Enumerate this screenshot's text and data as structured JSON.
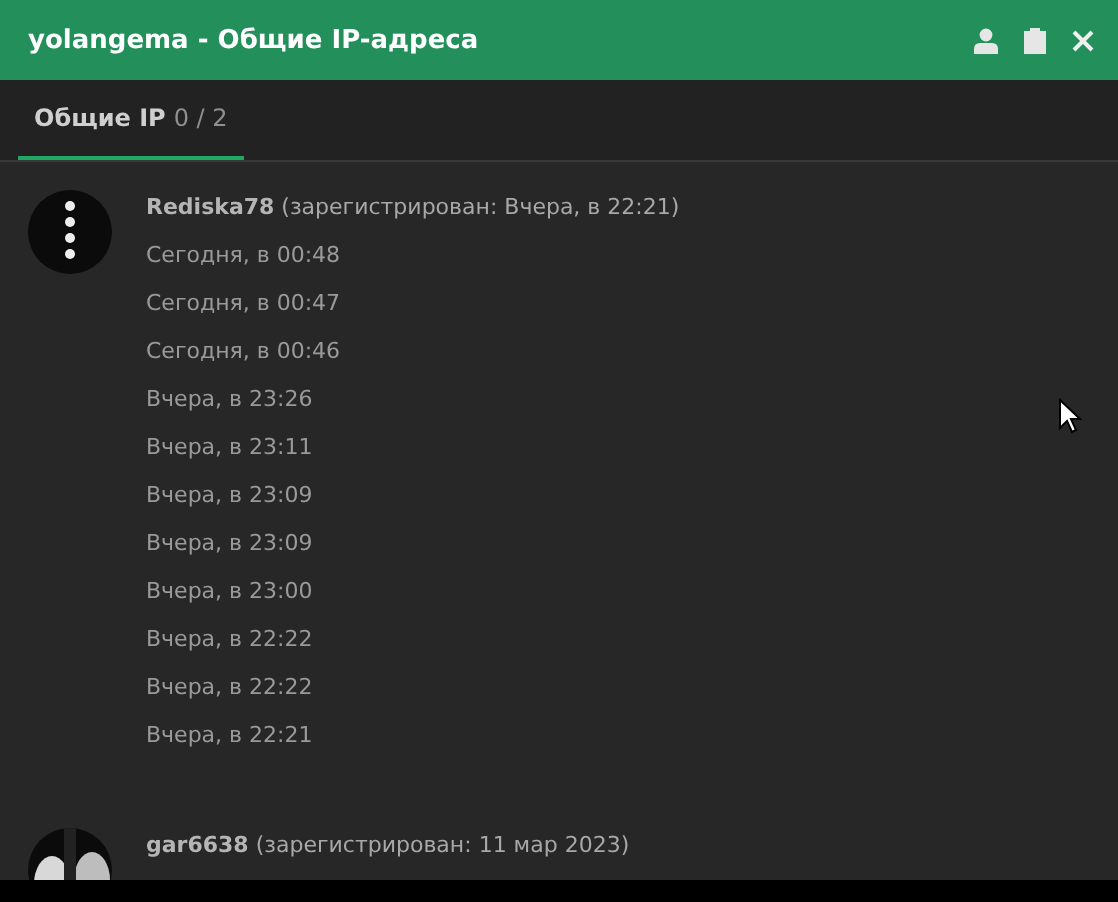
{
  "window": {
    "title": "yolangema - Общие IP-адреса"
  },
  "tabs": [
    {
      "label": "**Общие IP** 0 / 2",
      "selected": true
    }
  ],
  "users": [
    {
      "heading": "**Rediska78** (зарегистрирован: Вчера, в 22:21)",
      "times": [
        "Сегодня, в 00:48",
        "Сегодня, в 00:47",
        "Сегодня, в 00:46",
        "Вчера, в 23:26",
        "Вчера, в 23:11",
        "Вчера, в 23:09",
        "Вчера, в 23:09",
        "Вчера, в 23:00",
        "Вчера, в 22:22",
        "Вчера, в 22:22",
        "Вчера, в 22:21"
      ]
    },
    {
      "heading": "**gar6638** (зарегистрирован: 11 мар 2023)"
    }
  ]
}
